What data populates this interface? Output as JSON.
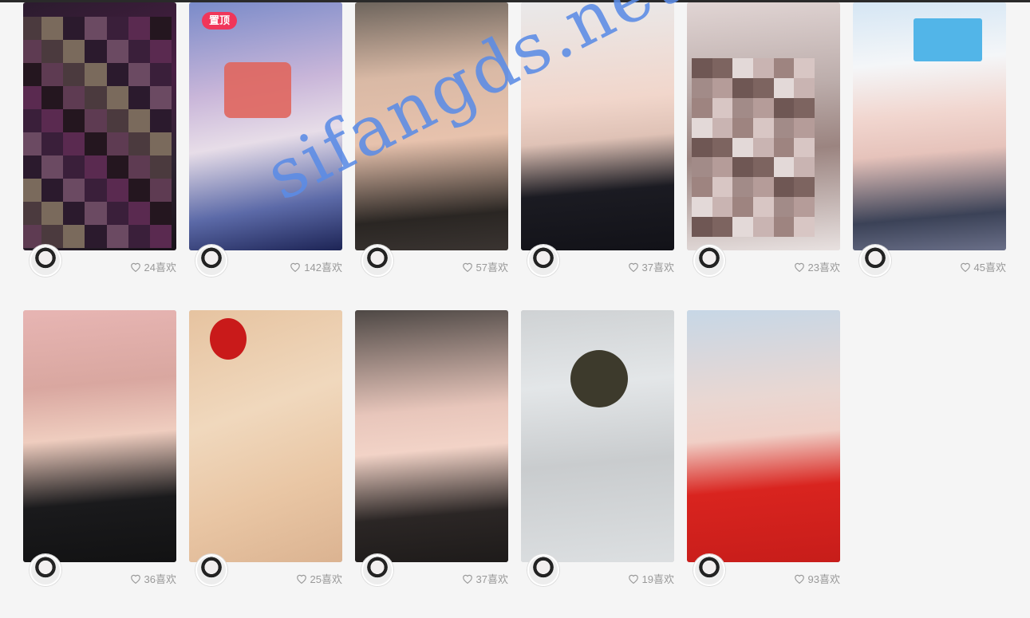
{
  "watermark": "sifangds.net",
  "pin_label": "置顶",
  "row1": [
    {
      "likes": "24喜欢",
      "pinned": false,
      "bg": "linear-gradient(160deg,#2b1b2e,#4a1f44 40%,#2e2432 70%,#19121a)"
    },
    {
      "likes": "142喜欢",
      "pinned": true,
      "bg": "linear-gradient(170deg,#7a8bc9,#c9b6d9 35%,#e7dde8 55%,#5c6aa8 80%,#1d2455)"
    },
    {
      "likes": "57喜欢",
      "pinned": false,
      "bg": "linear-gradient(175deg,#6e655d,#d9b9a5 30%,#e7c2ad 55%,#2a2623 85%,#3a3431)"
    },
    {
      "likes": "37喜欢",
      "pinned": false,
      "bg": "linear-gradient(175deg,#e9e9ea,#f1d6cb 40%,#dfc2b6 55%,#1b1b22 75%,#121218)"
    },
    {
      "likes": "23喜欢",
      "pinned": false,
      "bg": "linear-gradient(175deg,#e1d5d4,#bcadab 35%,#9b8480 60%,#e8e1e0 100%)"
    },
    {
      "likes": "45喜欢",
      "pinned": false,
      "bg": "linear-gradient(175deg,#d5e6f4,#f4f6f8 25%,#f1d6cf 45%,#e6c3bb 60%,#3b4257 85%,#6a6f88)"
    }
  ],
  "row2": [
    {
      "likes": "36喜欢",
      "bg": "linear-gradient(175deg,#e7b5b3,#d9a7a0 30%,#efcdbf 50%,#1a1a1c 75%,#121213)"
    },
    {
      "likes": "25喜欢",
      "bg": "linear-gradient(160deg,#e6c3a0,#f0d8bd 40%,#e9c6a4 70%,#dbb391)"
    },
    {
      "likes": "37喜欢",
      "bg": "linear-gradient(175deg,#4e4845,#e8c6bb 40%,#f2d3c7 55%,#2b2625 80%,#1e1b1a)"
    },
    {
      "likes": "19喜欢",
      "bg": "linear-gradient(175deg,#cfd2d4,#e3e6e8 30%,#c9ccce 60%,#dcdfe1 100%)"
    },
    {
      "likes": "93喜欢",
      "bg": "linear-gradient(175deg,#c7d7e6,#e9d7d2 35%,#f0cfc6 50%,#d9241f 70%,#c71d1a)"
    }
  ]
}
